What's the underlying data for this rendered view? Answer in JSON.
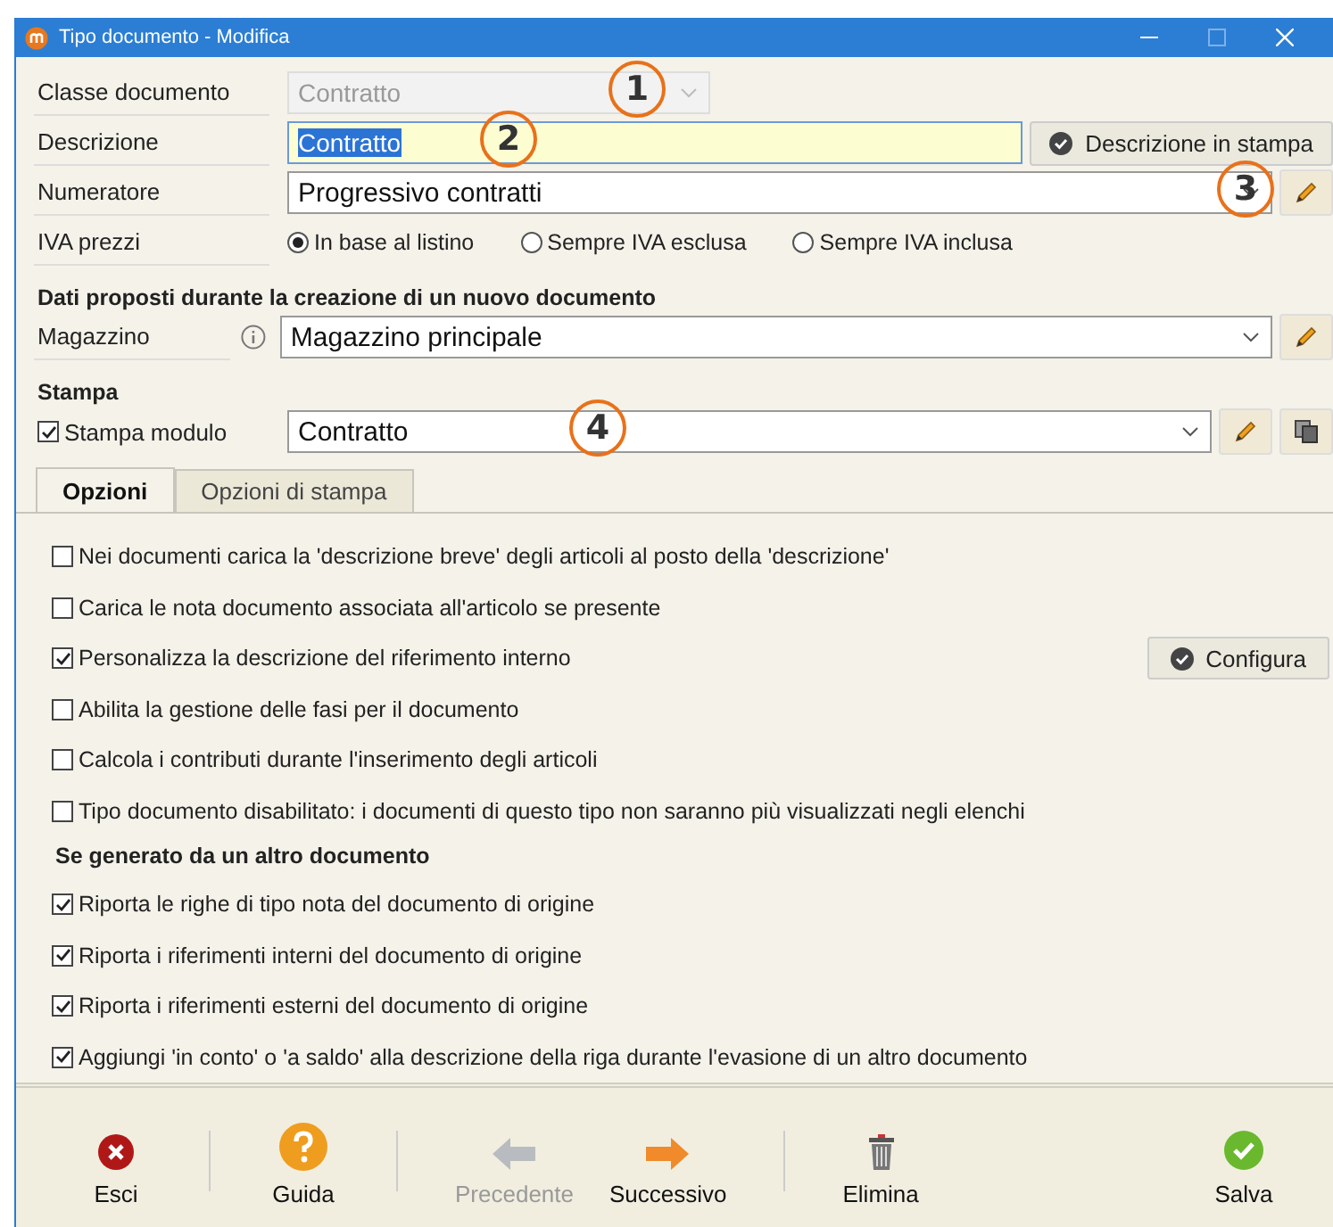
{
  "window": {
    "title": "Tipo documento - Modifica"
  },
  "classe": {
    "label": "Classe documento",
    "value": "Contratto",
    "disabled": true,
    "callout": "1"
  },
  "descrizione": {
    "label": "Descrizione",
    "value": "Contratto",
    "focused": true,
    "callout": "2",
    "button": "Descrizione in stampa"
  },
  "numeratore": {
    "label": "Numeratore",
    "value": "Progressivo contratti",
    "callout": "3"
  },
  "iva": {
    "label": "IVA prezzi",
    "options": [
      {
        "label": "In base al listino",
        "selected": true
      },
      {
        "label": "Sempre IVA esclusa",
        "selected": false
      },
      {
        "label": "Sempre IVA inclusa",
        "selected": false
      }
    ]
  },
  "defaults": {
    "heading": "Dati proposti durante la creazione di un nuovo documento",
    "label": "Magazzino",
    "value": "Magazzino principale"
  },
  "stampa": {
    "heading": "Stampa",
    "label": "Stampa modulo",
    "checked": true,
    "value": "Contratto",
    "callout": "4"
  },
  "tabs": [
    {
      "label": "Opzioni",
      "selected": true
    },
    {
      "label": "Opzioni di stampa",
      "selected": false
    }
  ],
  "options": [
    {
      "label": "Nei documenti carica la 'descrizione breve' degli articoli al posto della 'descrizione'",
      "checked": false
    },
    {
      "label": "Carica le nota documento associata all'articolo se presente",
      "checked": false
    },
    {
      "label": "Personalizza la descrizione del riferimento interno",
      "checked": true,
      "button": "Configura"
    },
    {
      "label": "Abilita la gestione delle fasi per il documento",
      "checked": false
    },
    {
      "label": "Calcola i contributi durante l'inserimento degli articoli",
      "checked": false
    },
    {
      "label": "Tipo documento disabilitato: i documenti di questo tipo non saranno più visualizzati negli elenchi",
      "checked": false
    }
  ],
  "generated": {
    "heading": "Se generato da un altro documento",
    "options": [
      {
        "label": "Riporta le righe di tipo nota del documento di origine",
        "checked": true
      },
      {
        "label": "Riporta i riferimenti interni del documento di origine",
        "checked": true
      },
      {
        "label": "Riporta i riferimenti esterni del documento di origine",
        "checked": true
      },
      {
        "label": "Aggiungi 'in conto' o 'a saldo' alla descrizione della riga durante l'evasione di un altro documento",
        "checked": true
      }
    ]
  },
  "toolbar": [
    {
      "kind": "close",
      "label": "Esci",
      "disabled": false
    },
    {
      "kind": "help",
      "label": "Guida",
      "disabled": false
    },
    {
      "kind": "prev",
      "label": "Precedente",
      "disabled": true
    },
    {
      "kind": "next",
      "label": "Successivo",
      "disabled": false
    },
    {
      "kind": "delete",
      "label": "Elimina",
      "disabled": false
    },
    {
      "kind": "save",
      "label": "Salva",
      "disabled": false
    }
  ]
}
